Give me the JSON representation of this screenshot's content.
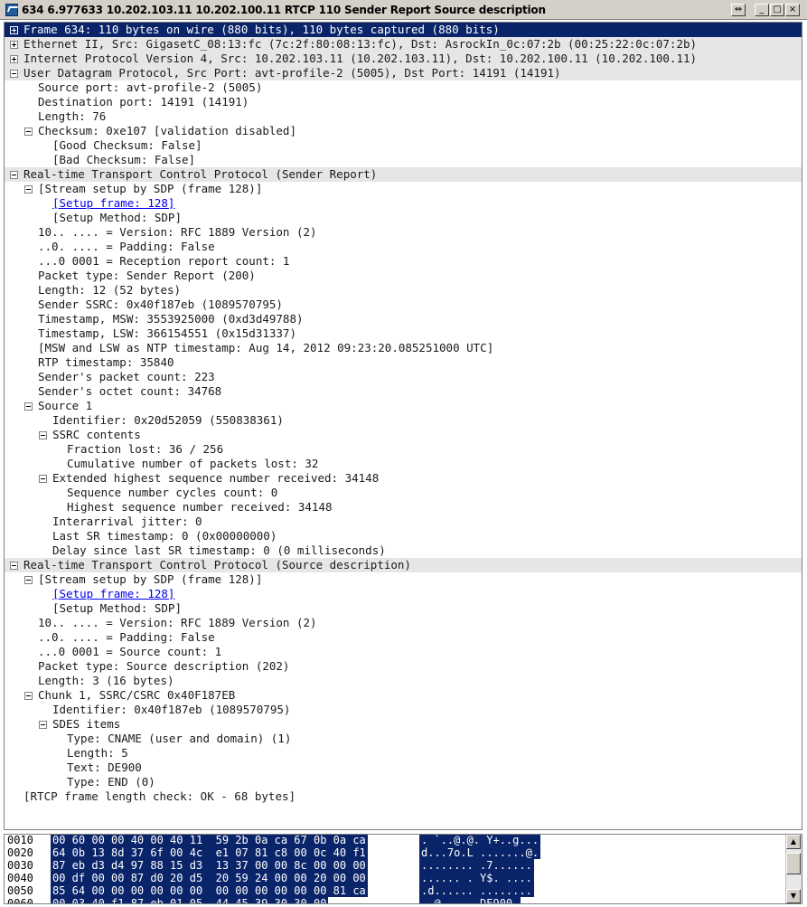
{
  "window": {
    "title": "634 6.977633 10.202.103.11 10.202.100.11 RTCP 110 Sender Report  Source description",
    "restore_icon": "resize-icon",
    "minimize_label": "_",
    "maximize_label": "□",
    "close_label": "×"
  },
  "tree": [
    {
      "indent": 0,
      "expander": "plus",
      "style": "sel",
      "text": "Frame 634: 110 bytes on wire (880 bits), 110 bytes captured (880 bits)"
    },
    {
      "indent": 0,
      "expander": "plus",
      "style": "hdr",
      "text": "Ethernet II, Src: GigasetC_08:13:fc (7c:2f:80:08:13:fc), Dst: AsrockIn_0c:07:2b (00:25:22:0c:07:2b)"
    },
    {
      "indent": 0,
      "expander": "plus",
      "style": "hdr",
      "text": "Internet Protocol Version 4, Src: 10.202.103.11 (10.202.103.11), Dst: 10.202.100.11 (10.202.100.11)"
    },
    {
      "indent": 0,
      "expander": "minus",
      "style": "hdr",
      "text": "User Datagram Protocol, Src Port: avt-profile-2 (5005), Dst Port: 14191 (14191)"
    },
    {
      "indent": 1,
      "expander": "",
      "style": "",
      "text": "Source port: avt-profile-2 (5005)"
    },
    {
      "indent": 1,
      "expander": "",
      "style": "",
      "text": "Destination port: 14191 (14191)"
    },
    {
      "indent": 1,
      "expander": "",
      "style": "",
      "text": "Length: 76"
    },
    {
      "indent": 1,
      "expander": "minus",
      "style": "",
      "text": "Checksum: 0xe107 [validation disabled]"
    },
    {
      "indent": 2,
      "expander": "",
      "style": "",
      "text": "[Good Checksum: False]"
    },
    {
      "indent": 2,
      "expander": "",
      "style": "",
      "text": "[Bad Checksum: False]"
    },
    {
      "indent": 0,
      "expander": "minus",
      "style": "hdr",
      "text": "Real-time Transport Control Protocol (Sender Report)"
    },
    {
      "indent": 1,
      "expander": "minus",
      "style": "",
      "text": "[Stream setup by SDP (frame 128)]"
    },
    {
      "indent": 2,
      "expander": "",
      "style": "link",
      "text": "[Setup frame: 128]"
    },
    {
      "indent": 2,
      "expander": "",
      "style": "",
      "text": "[Setup Method: SDP]"
    },
    {
      "indent": 1,
      "expander": "",
      "style": "",
      "text": "10.. .... = Version: RFC 1889 Version (2)"
    },
    {
      "indent": 1,
      "expander": "",
      "style": "",
      "text": "..0. .... = Padding: False"
    },
    {
      "indent": 1,
      "expander": "",
      "style": "",
      "text": "...0 0001 = Reception report count: 1"
    },
    {
      "indent": 1,
      "expander": "",
      "style": "",
      "text": "Packet type: Sender Report (200)"
    },
    {
      "indent": 1,
      "expander": "",
      "style": "",
      "text": "Length: 12 (52 bytes)"
    },
    {
      "indent": 1,
      "expander": "",
      "style": "",
      "text": "Sender SSRC: 0x40f187eb (1089570795)"
    },
    {
      "indent": 1,
      "expander": "",
      "style": "",
      "text": "Timestamp, MSW: 3553925000 (0xd3d49788)"
    },
    {
      "indent": 1,
      "expander": "",
      "style": "",
      "text": "Timestamp, LSW: 366154551 (0x15d31337)"
    },
    {
      "indent": 1,
      "expander": "",
      "style": "",
      "text": "[MSW and LSW as NTP timestamp: Aug 14, 2012 09:23:20.085251000 UTC]"
    },
    {
      "indent": 1,
      "expander": "",
      "style": "",
      "text": "RTP timestamp: 35840"
    },
    {
      "indent": 1,
      "expander": "",
      "style": "",
      "text": "Sender's packet count: 223"
    },
    {
      "indent": 1,
      "expander": "",
      "style": "",
      "text": "Sender's octet count: 34768"
    },
    {
      "indent": 1,
      "expander": "minus",
      "style": "",
      "text": "Source 1"
    },
    {
      "indent": 2,
      "expander": "",
      "style": "",
      "text": "Identifier: 0x20d52059 (550838361)"
    },
    {
      "indent": 2,
      "expander": "minus",
      "style": "",
      "text": "SSRC contents"
    },
    {
      "indent": 3,
      "expander": "",
      "style": "",
      "text": "Fraction lost: 36 / 256"
    },
    {
      "indent": 3,
      "expander": "",
      "style": "",
      "text": "Cumulative number of packets lost: 32"
    },
    {
      "indent": 2,
      "expander": "minus",
      "style": "",
      "text": "Extended highest sequence number received: 34148"
    },
    {
      "indent": 3,
      "expander": "",
      "style": "",
      "text": "Sequence number cycles count: 0"
    },
    {
      "indent": 3,
      "expander": "",
      "style": "",
      "text": "Highest sequence number received: 34148"
    },
    {
      "indent": 2,
      "expander": "",
      "style": "",
      "text": "Interarrival jitter: 0"
    },
    {
      "indent": 2,
      "expander": "",
      "style": "",
      "text": "Last SR timestamp: 0 (0x00000000)"
    },
    {
      "indent": 2,
      "expander": "",
      "style": "",
      "text": "Delay since last SR timestamp: 0 (0 milliseconds)"
    },
    {
      "indent": 0,
      "expander": "minus",
      "style": "hdr",
      "text": "Real-time Transport Control Protocol (Source description)"
    },
    {
      "indent": 1,
      "expander": "minus",
      "style": "",
      "text": "[Stream setup by SDP (frame 128)]"
    },
    {
      "indent": 2,
      "expander": "",
      "style": "link",
      "text": "[Setup frame: 128]"
    },
    {
      "indent": 2,
      "expander": "",
      "style": "",
      "text": "[Setup Method: SDP]"
    },
    {
      "indent": 1,
      "expander": "",
      "style": "",
      "text": "10.. .... = Version: RFC 1889 Version (2)"
    },
    {
      "indent": 1,
      "expander": "",
      "style": "",
      "text": "..0. .... = Padding: False"
    },
    {
      "indent": 1,
      "expander": "",
      "style": "",
      "text": "...0 0001 = Source count: 1"
    },
    {
      "indent": 1,
      "expander": "",
      "style": "",
      "text": "Packet type: Source description (202)"
    },
    {
      "indent": 1,
      "expander": "",
      "style": "",
      "text": "Length: 3 (16 bytes)"
    },
    {
      "indent": 1,
      "expander": "minus",
      "style": "",
      "text": "Chunk 1, SSRC/CSRC 0x40F187EB"
    },
    {
      "indent": 2,
      "expander": "",
      "style": "",
      "text": "Identifier: 0x40f187eb (1089570795)"
    },
    {
      "indent": 2,
      "expander": "minus",
      "style": "",
      "text": "SDES items"
    },
    {
      "indent": 3,
      "expander": "",
      "style": "",
      "text": "Type: CNAME (user and domain) (1)"
    },
    {
      "indent": 3,
      "expander": "",
      "style": "",
      "text": "Length: 5"
    },
    {
      "indent": 3,
      "expander": "",
      "style": "",
      "text": "Text: DE900"
    },
    {
      "indent": 3,
      "expander": "",
      "style": "",
      "text": "Type: END (0)"
    },
    {
      "indent": 0,
      "expander": "",
      "style": "",
      "text": "[RTCP frame length check: OK - 68 bytes]"
    }
  ],
  "bytes": [
    {
      "offset": "0010",
      "hex": "00 60 00 00 40 00 40 11  59 2b 0a ca 67 0b 0a ca",
      "ascii": ". `..@.@. Y+..g..."
    },
    {
      "offset": "0020",
      "hex": "64 0b 13 8d 37 6f 00 4c  e1 07 81 c8 00 0c 40 f1",
      "ascii": "d...7o.L .......@."
    },
    {
      "offset": "0030",
      "hex": "87 eb d3 d4 97 88 15 d3  13 37 00 00 8c 00 00 00",
      "ascii": "........ .7......"
    },
    {
      "offset": "0040",
      "hex": "00 df 00 00 87 d0 20 d5  20 59 24 00 00 20 00 00",
      "ascii": "...... . Y$. ...."
    },
    {
      "offset": "0050",
      "hex": "85 64 00 00 00 00 00 00  00 00 00 00 00 00 81 ca",
      "ascii": ".d...... ........"
    },
    {
      "offset": "0060",
      "hex": "00 03 40 f1 87 eb 01 05  44 45 39 30 30 00",
      "ascii": "..@..... DE900."
    }
  ],
  "colors": {
    "selection": "#0a246a",
    "header_row": "#e6e6e6",
    "link": "#0000ee"
  }
}
